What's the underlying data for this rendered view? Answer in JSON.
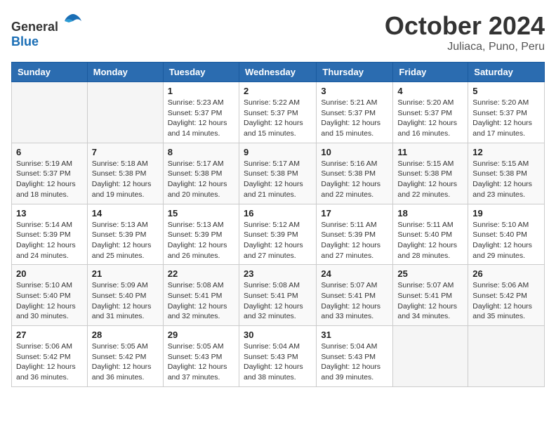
{
  "logo": {
    "general": "General",
    "blue": "Blue"
  },
  "title": "October 2024",
  "location": "Juliaca, Puno, Peru",
  "days_of_week": [
    "Sunday",
    "Monday",
    "Tuesday",
    "Wednesday",
    "Thursday",
    "Friday",
    "Saturday"
  ],
  "weeks": [
    [
      {
        "day": "",
        "info": ""
      },
      {
        "day": "",
        "info": ""
      },
      {
        "day": "1",
        "info": "Sunrise: 5:23 AM\nSunset: 5:37 PM\nDaylight: 12 hours and 14 minutes."
      },
      {
        "day": "2",
        "info": "Sunrise: 5:22 AM\nSunset: 5:37 PM\nDaylight: 12 hours and 15 minutes."
      },
      {
        "day": "3",
        "info": "Sunrise: 5:21 AM\nSunset: 5:37 PM\nDaylight: 12 hours and 15 minutes."
      },
      {
        "day": "4",
        "info": "Sunrise: 5:20 AM\nSunset: 5:37 PM\nDaylight: 12 hours and 16 minutes."
      },
      {
        "day": "5",
        "info": "Sunrise: 5:20 AM\nSunset: 5:37 PM\nDaylight: 12 hours and 17 minutes."
      }
    ],
    [
      {
        "day": "6",
        "info": "Sunrise: 5:19 AM\nSunset: 5:37 PM\nDaylight: 12 hours and 18 minutes."
      },
      {
        "day": "7",
        "info": "Sunrise: 5:18 AM\nSunset: 5:38 PM\nDaylight: 12 hours and 19 minutes."
      },
      {
        "day": "8",
        "info": "Sunrise: 5:17 AM\nSunset: 5:38 PM\nDaylight: 12 hours and 20 minutes."
      },
      {
        "day": "9",
        "info": "Sunrise: 5:17 AM\nSunset: 5:38 PM\nDaylight: 12 hours and 21 minutes."
      },
      {
        "day": "10",
        "info": "Sunrise: 5:16 AM\nSunset: 5:38 PM\nDaylight: 12 hours and 22 minutes."
      },
      {
        "day": "11",
        "info": "Sunrise: 5:15 AM\nSunset: 5:38 PM\nDaylight: 12 hours and 22 minutes."
      },
      {
        "day": "12",
        "info": "Sunrise: 5:15 AM\nSunset: 5:38 PM\nDaylight: 12 hours and 23 minutes."
      }
    ],
    [
      {
        "day": "13",
        "info": "Sunrise: 5:14 AM\nSunset: 5:39 PM\nDaylight: 12 hours and 24 minutes."
      },
      {
        "day": "14",
        "info": "Sunrise: 5:13 AM\nSunset: 5:39 PM\nDaylight: 12 hours and 25 minutes."
      },
      {
        "day": "15",
        "info": "Sunrise: 5:13 AM\nSunset: 5:39 PM\nDaylight: 12 hours and 26 minutes."
      },
      {
        "day": "16",
        "info": "Sunrise: 5:12 AM\nSunset: 5:39 PM\nDaylight: 12 hours and 27 minutes."
      },
      {
        "day": "17",
        "info": "Sunrise: 5:11 AM\nSunset: 5:39 PM\nDaylight: 12 hours and 27 minutes."
      },
      {
        "day": "18",
        "info": "Sunrise: 5:11 AM\nSunset: 5:40 PM\nDaylight: 12 hours and 28 minutes."
      },
      {
        "day": "19",
        "info": "Sunrise: 5:10 AM\nSunset: 5:40 PM\nDaylight: 12 hours and 29 minutes."
      }
    ],
    [
      {
        "day": "20",
        "info": "Sunrise: 5:10 AM\nSunset: 5:40 PM\nDaylight: 12 hours and 30 minutes."
      },
      {
        "day": "21",
        "info": "Sunrise: 5:09 AM\nSunset: 5:40 PM\nDaylight: 12 hours and 31 minutes."
      },
      {
        "day": "22",
        "info": "Sunrise: 5:08 AM\nSunset: 5:41 PM\nDaylight: 12 hours and 32 minutes."
      },
      {
        "day": "23",
        "info": "Sunrise: 5:08 AM\nSunset: 5:41 PM\nDaylight: 12 hours and 32 minutes."
      },
      {
        "day": "24",
        "info": "Sunrise: 5:07 AM\nSunset: 5:41 PM\nDaylight: 12 hours and 33 minutes."
      },
      {
        "day": "25",
        "info": "Sunrise: 5:07 AM\nSunset: 5:41 PM\nDaylight: 12 hours and 34 minutes."
      },
      {
        "day": "26",
        "info": "Sunrise: 5:06 AM\nSunset: 5:42 PM\nDaylight: 12 hours and 35 minutes."
      }
    ],
    [
      {
        "day": "27",
        "info": "Sunrise: 5:06 AM\nSunset: 5:42 PM\nDaylight: 12 hours and 36 minutes."
      },
      {
        "day": "28",
        "info": "Sunrise: 5:05 AM\nSunset: 5:42 PM\nDaylight: 12 hours and 36 minutes."
      },
      {
        "day": "29",
        "info": "Sunrise: 5:05 AM\nSunset: 5:43 PM\nDaylight: 12 hours and 37 minutes."
      },
      {
        "day": "30",
        "info": "Sunrise: 5:04 AM\nSunset: 5:43 PM\nDaylight: 12 hours and 38 minutes."
      },
      {
        "day": "31",
        "info": "Sunrise: 5:04 AM\nSunset: 5:43 PM\nDaylight: 12 hours and 39 minutes."
      },
      {
        "day": "",
        "info": ""
      },
      {
        "day": "",
        "info": ""
      }
    ]
  ]
}
